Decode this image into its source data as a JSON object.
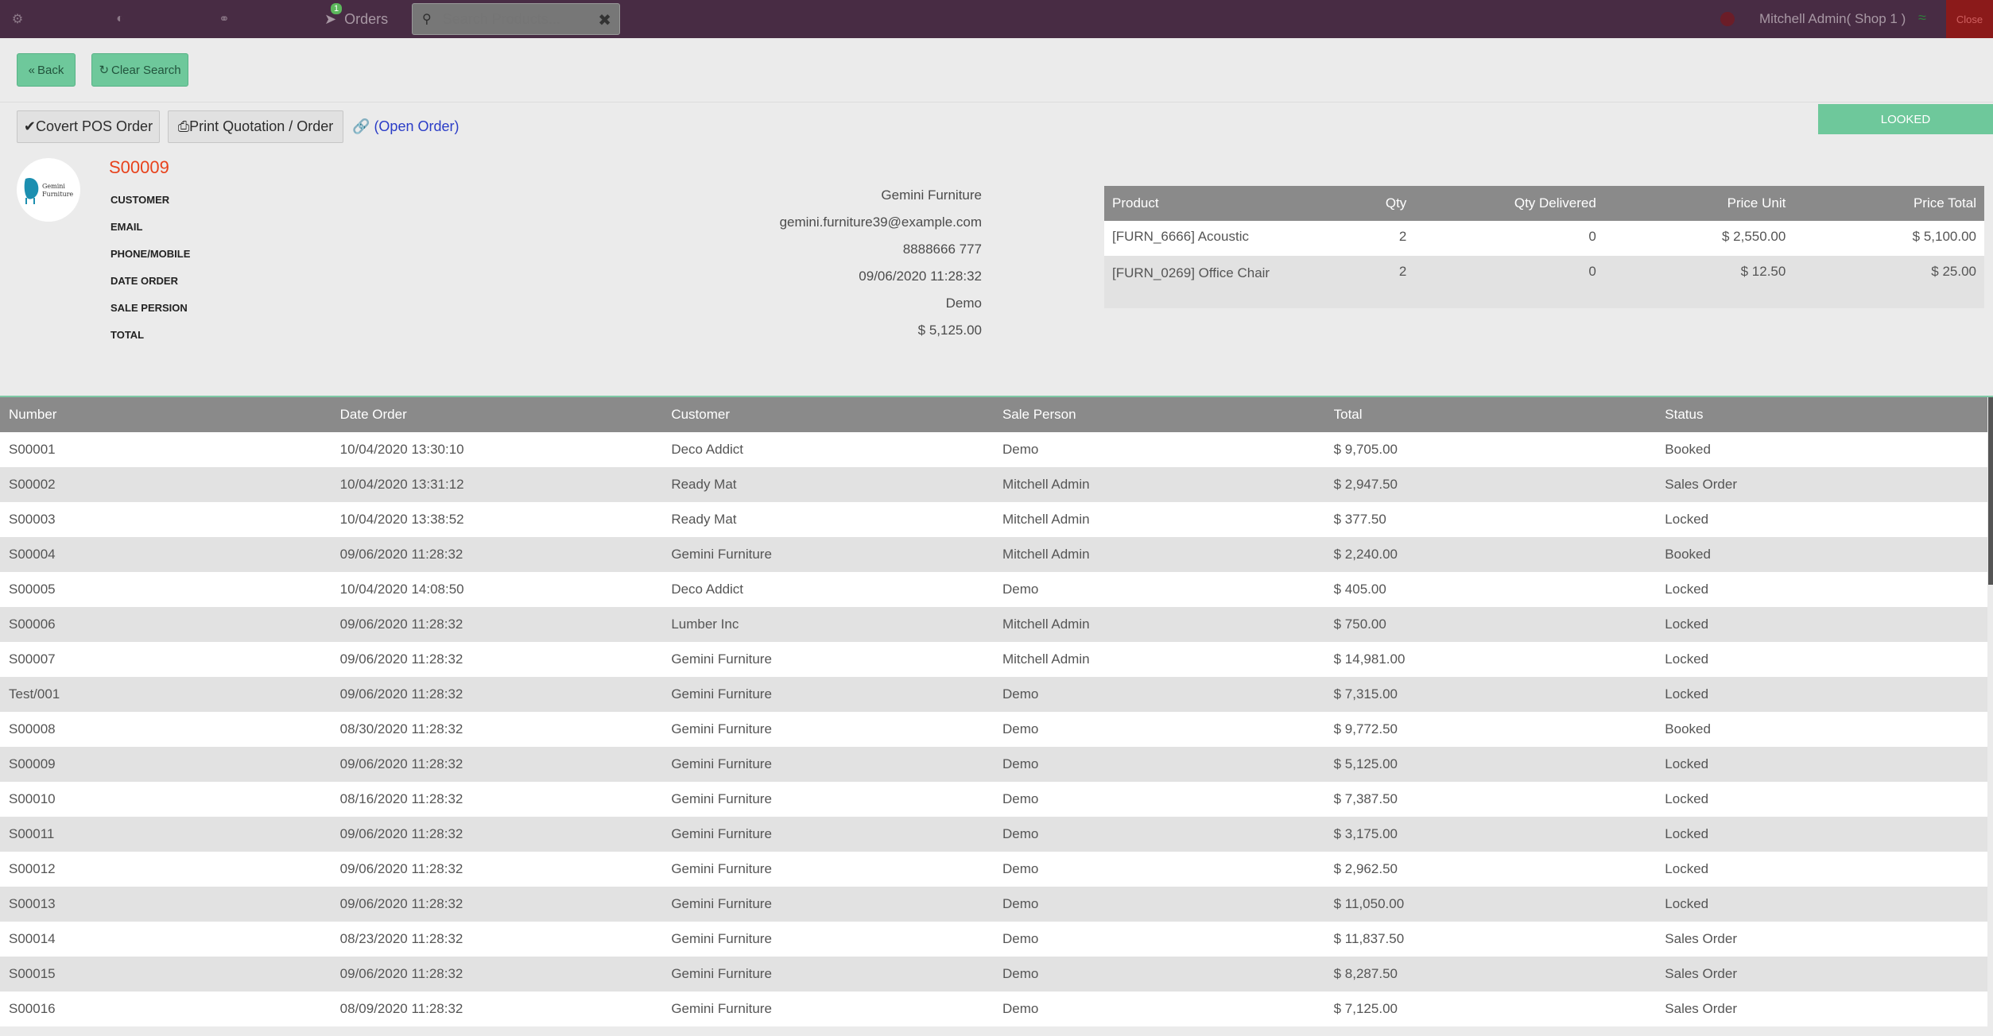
{
  "topbar": {
    "orders_label": "Orders",
    "orders_badge": "1",
    "search_placeholder": "Search Products...",
    "user_label": "Mitchell Admin( Shop 1 )",
    "close_label": "Close"
  },
  "actions": {
    "back_label": "Back",
    "clear_search_label": "Clear Search",
    "convert_label": "Covert POS Order",
    "print_label": "Print Quotation / Order",
    "open_order_label": "(Open Order)",
    "status_banner": "LOOKED"
  },
  "order": {
    "number": "S00009",
    "logo_text": "Gemini Furniture",
    "fields": [
      {
        "label": "CUSTOMER",
        "value": "Gemini Furniture"
      },
      {
        "label": "EMAIL",
        "value": "gemini.furniture39@example.com"
      },
      {
        "label": "PHONE/MOBILE",
        "value": "8888666 777"
      },
      {
        "label": "DATE ORDER",
        "value": "09/06/2020 11:28:32"
      },
      {
        "label": "SALE PERSION",
        "value": "Demo"
      },
      {
        "label": "TOTAL",
        "value": "$ 5,125.00"
      }
    ]
  },
  "products": {
    "headers": [
      "Product",
      "Qty",
      "Qty Delivered",
      "Price Unit",
      "Price Total"
    ],
    "rows": [
      {
        "product": "[FURN_6666] Acoustic",
        "qty": "2",
        "delivered": "0",
        "unit": "$ 2,550.00",
        "total": "$ 5,100.00"
      },
      {
        "product": "[FURN_0269] Office Chair",
        "qty": "2",
        "delivered": "0",
        "unit": "$ 12.50",
        "total": "$ 25.00"
      }
    ]
  },
  "orders_list": {
    "headers": [
      "Number",
      "Date Order",
      "Customer",
      "Sale Person",
      "Total",
      "Status"
    ],
    "rows": [
      [
        "S00001",
        "10/04/2020 13:30:10",
        "Deco Addict",
        "Demo",
        "$ 9,705.00",
        "Booked"
      ],
      [
        "S00002",
        "10/04/2020 13:31:12",
        "Ready Mat",
        "Mitchell Admin",
        "$ 2,947.50",
        "Sales Order"
      ],
      [
        "S00003",
        "10/04/2020 13:38:52",
        "Ready Mat",
        "Mitchell Admin",
        "$ 377.50",
        "Locked"
      ],
      [
        "S00004",
        "09/06/2020 11:28:32",
        "Gemini Furniture",
        "Mitchell Admin",
        "$ 2,240.00",
        "Booked"
      ],
      [
        "S00005",
        "10/04/2020 14:08:50",
        "Deco Addict",
        "Demo",
        "$ 405.00",
        "Locked"
      ],
      [
        "S00006",
        "09/06/2020 11:28:32",
        "Lumber Inc",
        "Mitchell Admin",
        "$ 750.00",
        "Locked"
      ],
      [
        "S00007",
        "09/06/2020 11:28:32",
        "Gemini Furniture",
        "Mitchell Admin",
        "$ 14,981.00",
        "Locked"
      ],
      [
        "Test/001",
        "09/06/2020 11:28:32",
        "Gemini Furniture",
        "Demo",
        "$ 7,315.00",
        "Locked"
      ],
      [
        "S00008",
        "08/30/2020 11:28:32",
        "Gemini Furniture",
        "Demo",
        "$ 9,772.50",
        "Booked"
      ],
      [
        "S00009",
        "09/06/2020 11:28:32",
        "Gemini Furniture",
        "Demo",
        "$ 5,125.00",
        "Locked"
      ],
      [
        "S00010",
        "08/16/2020 11:28:32",
        "Gemini Furniture",
        "Demo",
        "$ 7,387.50",
        "Locked"
      ],
      [
        "S00011",
        "09/06/2020 11:28:32",
        "Gemini Furniture",
        "Demo",
        "$ 3,175.00",
        "Locked"
      ],
      [
        "S00012",
        "09/06/2020 11:28:32",
        "Gemini Furniture",
        "Demo",
        "$ 2,962.50",
        "Locked"
      ],
      [
        "S00013",
        "09/06/2020 11:28:32",
        "Gemini Furniture",
        "Demo",
        "$ 11,050.00",
        "Locked"
      ],
      [
        "S00014",
        "08/23/2020 11:28:32",
        "Gemini Furniture",
        "Demo",
        "$ 11,837.50",
        "Sales Order"
      ],
      [
        "S00015",
        "09/06/2020 11:28:32",
        "Gemini Furniture",
        "Demo",
        "$ 8,287.50",
        "Sales Order"
      ],
      [
        "S00016",
        "08/09/2020 11:28:32",
        "Gemini Furniture",
        "Demo",
        "$ 7,125.00",
        "Sales Order"
      ]
    ]
  }
}
